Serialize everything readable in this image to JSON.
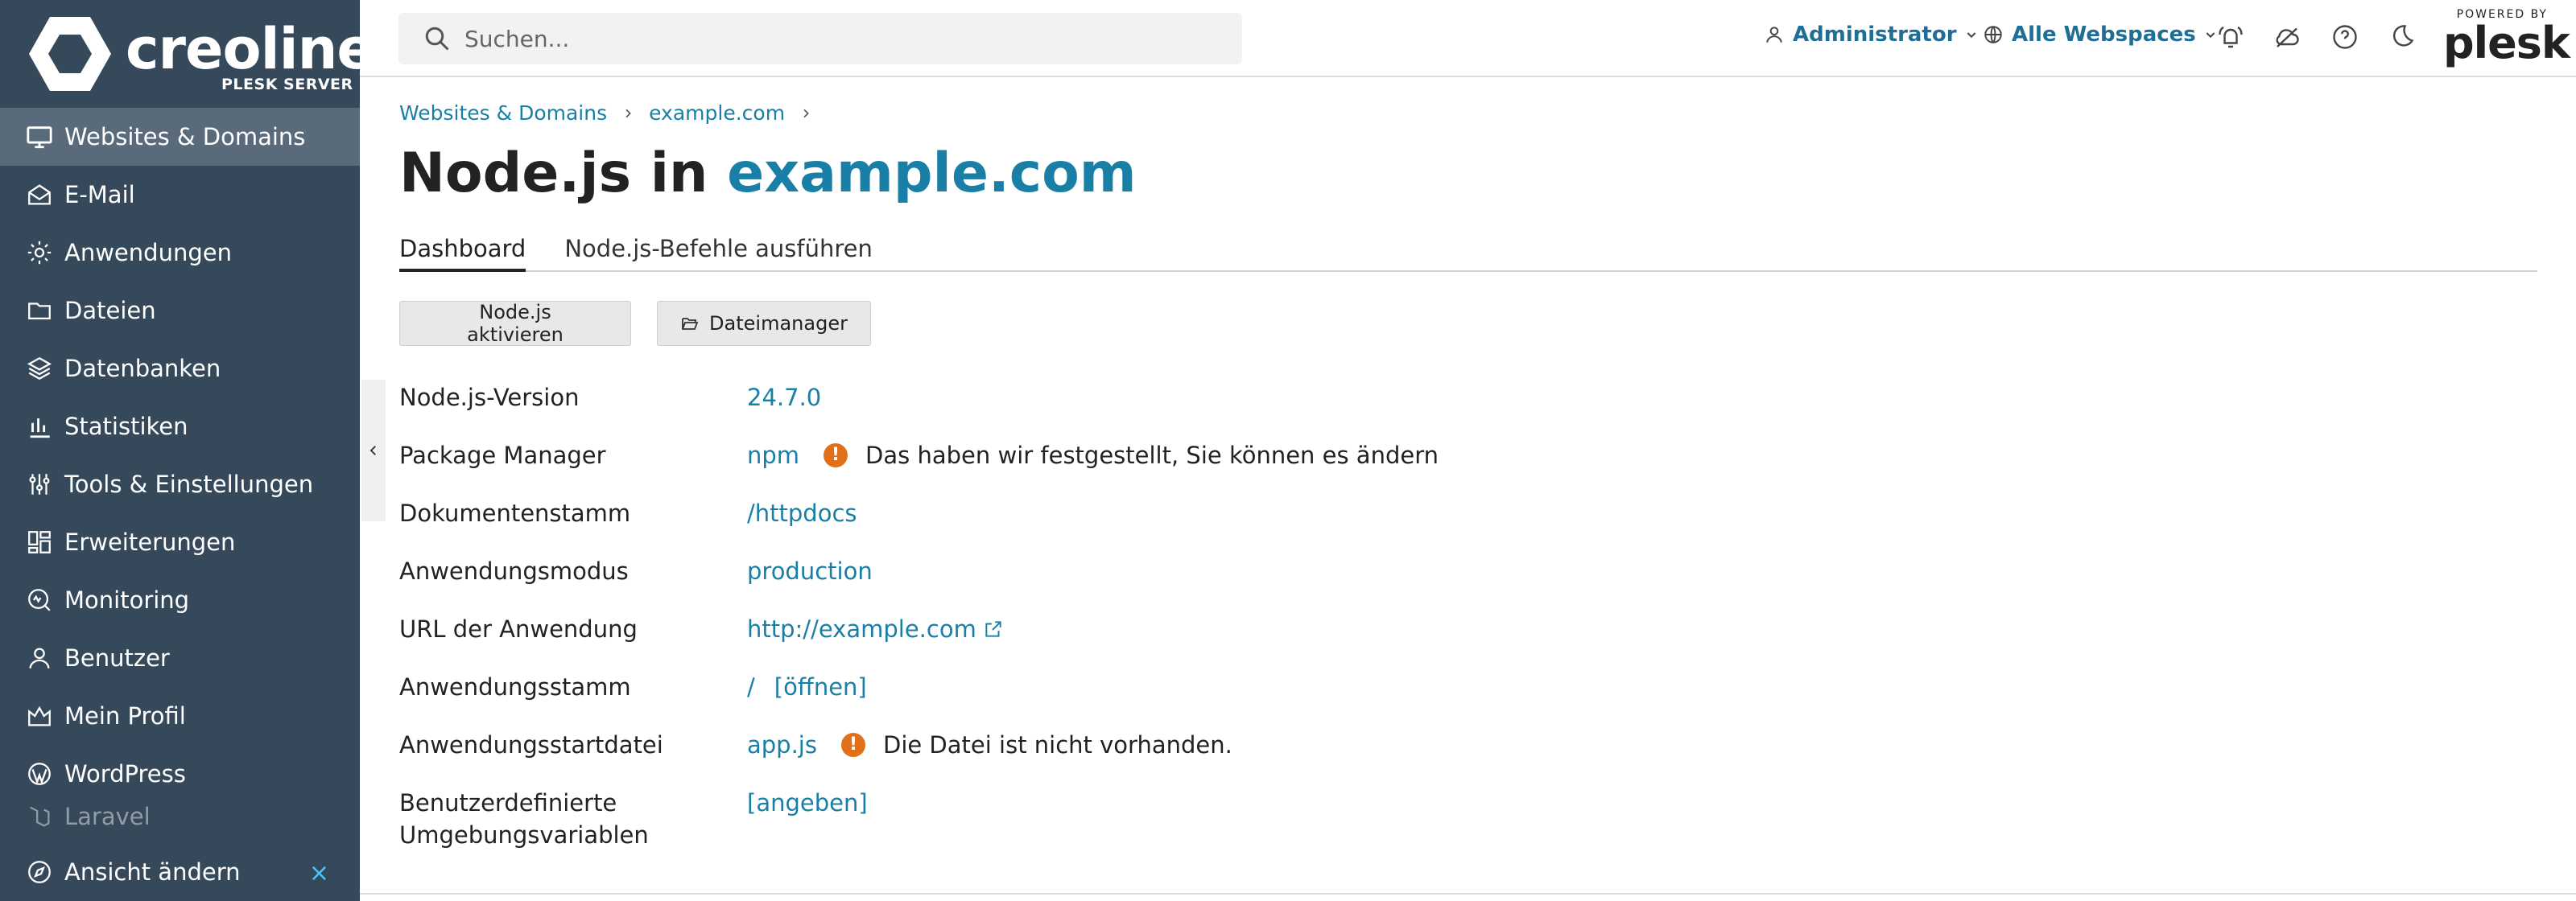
{
  "brand": {
    "name": "creoline",
    "registered": "®",
    "subtitle": "PLESK SERVER"
  },
  "sidebar": {
    "items": [
      {
        "label": "Websites & Domains",
        "icon": "monitor-icon",
        "active": true
      },
      {
        "label": "E-Mail",
        "icon": "mail-icon"
      },
      {
        "label": "Anwendungen",
        "icon": "gear-icon"
      },
      {
        "label": "Dateien",
        "icon": "folder-icon"
      },
      {
        "label": "Datenbanken",
        "icon": "layers-icon"
      },
      {
        "label": "Statistiken",
        "icon": "bar-chart-icon"
      },
      {
        "label": "Tools & Einstellungen",
        "icon": "sliders-icon"
      },
      {
        "label": "Erweiterungen",
        "icon": "extensions-icon"
      },
      {
        "label": "Monitoring",
        "icon": "monitoring-icon"
      },
      {
        "label": "Benutzer",
        "icon": "user-icon"
      },
      {
        "label": "Mein Profil",
        "icon": "crown-icon"
      },
      {
        "label": "WordPress",
        "icon": "wordpress-icon"
      },
      {
        "label": "Laravel",
        "icon": "laravel-icon"
      }
    ],
    "footer": {
      "label": "Ansicht ändern",
      "close": "×"
    }
  },
  "header": {
    "search_placeholder": "Suchen...",
    "user": "Administrator",
    "webspaces": "Alle Webspaces",
    "plesk_powered": "POWERED BY",
    "plesk_word": "plesk"
  },
  "breadcrumb": [
    "Websites & Domains",
    "example.com"
  ],
  "title": {
    "prefix": "Node.js in",
    "domain": "example.com"
  },
  "tabs": [
    {
      "label": "Dashboard",
      "active": true
    },
    {
      "label": "Node.js-Befehle ausführen"
    }
  ],
  "buttons": {
    "activate": "Node.js aktivieren",
    "file_manager": "Dateimanager"
  },
  "info": {
    "node_version": {
      "label": "Node.js-Version",
      "value": "24.7.0"
    },
    "package_manager": {
      "label": "Package Manager",
      "value": "npm",
      "note": "Das haben wir festgestellt, Sie können es ändern"
    },
    "document_root": {
      "label": "Dokumentenstamm",
      "value": "/httpdocs"
    },
    "app_mode": {
      "label": "Anwendungsmodus",
      "value": "production"
    },
    "app_url": {
      "label": "URL der Anwendung",
      "value": "http://example.com"
    },
    "app_root": {
      "label": "Anwendungsstamm",
      "value": "/",
      "action": "[öffnen]"
    },
    "startup_file": {
      "label": "Anwendungsstartdatei",
      "value": "app.js",
      "note": "Die Datei ist nicht vorhanden."
    },
    "env_vars": {
      "label_line1": "Benutzerdefinierte",
      "label_line2": "Umgebungsvariablen",
      "action": "[angeben]"
    }
  },
  "warning_glyph": "!",
  "colors": {
    "sidebar": "#36495a",
    "sidebar_active": "#596b7b",
    "link": "#1a7fa6",
    "warning": "#e0701a"
  }
}
